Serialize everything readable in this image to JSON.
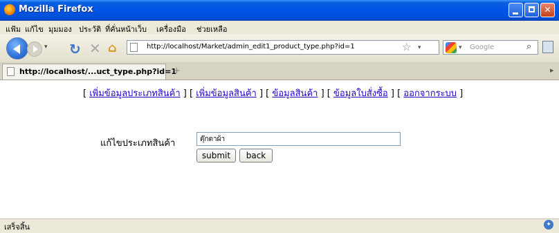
{
  "window": {
    "title": "Mozilla Firefox"
  },
  "menu": [
    "แฟ้ม",
    "แก้ไข",
    "มุมมอง",
    "ประวัติ",
    "ที่คั่นหน้าเว็บ",
    "เครื่องมือ",
    "ช่วยเหลือ"
  ],
  "nav": {
    "url": "http://localhost/Market/admin_edit1_product_type.php?id=1",
    "search_placeholder": "Google"
  },
  "tab": {
    "label": "http://localhost/...uct_type.php?id=1",
    "new_tab_symbol": "+"
  },
  "content": {
    "links": {
      "open": "[ ",
      "sep": " ] [ ",
      "close": " ]",
      "items": [
        "เพิ่มข้อมูลประเภทสินค้า",
        "เพิ่มข้อมูลสินค้า",
        "ข้อมูลสินค้า",
        "ข้อมูลใบสั่งซื้อ",
        "ออกจากระบบ"
      ]
    },
    "form": {
      "label": "แก้ไขประเภทสินค้า",
      "input_value": "ตุ๊กตาผ้า",
      "submit_label": "submit",
      "back_label": "back"
    }
  },
  "status": {
    "text": "เสร็จสิ้น"
  },
  "colors": {
    "link": "#2200CC",
    "titlebar": "#0055E5"
  }
}
